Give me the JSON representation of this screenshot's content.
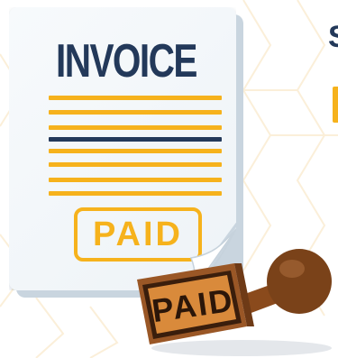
{
  "document": {
    "title": "INVOICE",
    "badge_label": "PAID"
  },
  "stamp": {
    "label": "PAID"
  },
  "side_text": "S",
  "colors": {
    "navy": "#23395a",
    "accent_orange": "#f6b21c",
    "paper": "#f3f7fa",
    "stamp_wood": "#7a4219",
    "stamp_rubber": "#3a1e0c"
  },
  "icons": [
    "invoice-document-icon",
    "page-curl-icon",
    "rubber-stamp-icon"
  ]
}
